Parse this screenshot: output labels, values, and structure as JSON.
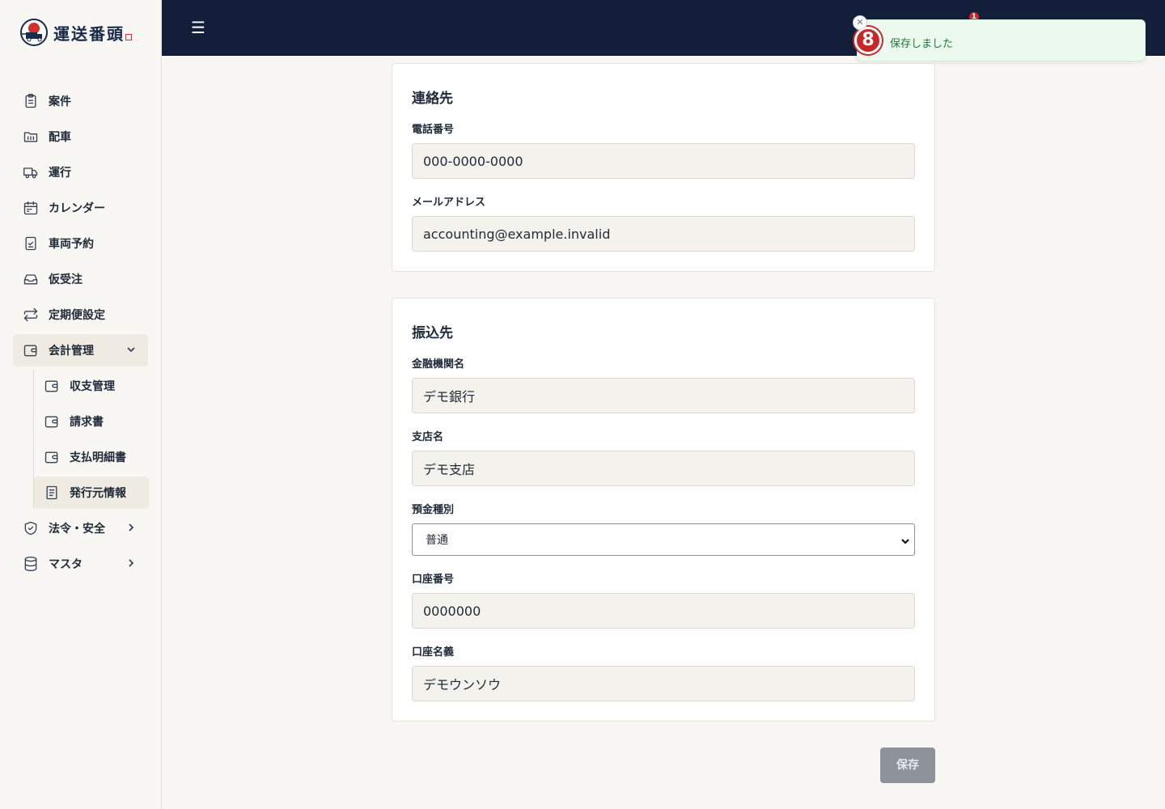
{
  "brand": {
    "name": "運送番頭"
  },
  "sidebar": {
    "items": [
      {
        "label": "案件",
        "icon": "clipboard-icon"
      },
      {
        "label": "配車",
        "icon": "folder-icon"
      },
      {
        "label": "運行",
        "icon": "truck-icon"
      },
      {
        "label": "カレンダー",
        "icon": "calendar-icon"
      },
      {
        "label": "車両予約",
        "icon": "clipboard-check-icon"
      },
      {
        "label": "仮受注",
        "icon": "inbox-icon"
      },
      {
        "label": "定期便設定",
        "icon": "repeat-icon"
      },
      {
        "label": "会計管理",
        "icon": "wallet-icon"
      },
      {
        "label": "法令・安全",
        "icon": "shield-check-icon"
      },
      {
        "label": "マスタ",
        "icon": "database-icon"
      }
    ],
    "accounting_sub": [
      {
        "label": "収支管理",
        "icon": "wallet-icon"
      },
      {
        "label": "請求書",
        "icon": "wallet-icon"
      },
      {
        "label": "支払明細書",
        "icon": "wallet-icon"
      },
      {
        "label": "発行元情報",
        "icon": "document-icon"
      }
    ]
  },
  "header": {
    "notification_count": "1"
  },
  "toast": {
    "message": "保存しました",
    "icon_glyph": "8"
  },
  "contact": {
    "title": "連絡先",
    "phone_label": "電話番号",
    "phone_value": "000-0000-0000",
    "email_label": "メールアドレス",
    "email_value": "accounting@example.invalid"
  },
  "bank": {
    "title": "振込先",
    "bank_name_label": "金融機関名",
    "bank_name_value": "デモ銀行",
    "branch_label": "支店名",
    "branch_value": "デモ支店",
    "account_type_label": "預金種別",
    "account_type_value": "普通",
    "account_number_label": "口座番号",
    "account_number_value": "0000000",
    "account_holder_label": "口座名義",
    "account_holder_value": "デモウンソウ"
  },
  "actions": {
    "save_label": "保存"
  },
  "colors": {
    "header_bg": "#131f3a",
    "sidebar_active": "#efebe2",
    "toast_bg": "#ecf9ef",
    "toast_text": "#1f7a3a",
    "badge": "#c62828",
    "save_disabled": "#8e929b"
  }
}
